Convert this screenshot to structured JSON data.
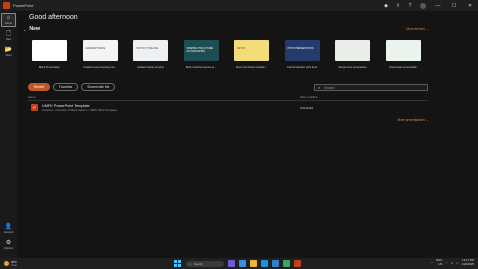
{
  "window": {
    "title": "PowerPoint",
    "controls": {
      "minimize": "—",
      "maximize": "☐",
      "close": "✕"
    },
    "top_icons": [
      "diamond-icon",
      "share-icon",
      "help-icon"
    ]
  },
  "rail": {
    "items": [
      {
        "label": "Home",
        "icon": "⌂",
        "name": "home"
      },
      {
        "label": "New",
        "icon": "🗋",
        "name": "new"
      },
      {
        "label": "Open",
        "icon": "📂",
        "name": "open"
      },
      {
        "label": "Account",
        "icon": "👤",
        "name": "account"
      },
      {
        "label": "Options",
        "icon": "⚙",
        "name": "options"
      }
    ]
  },
  "greeting": "Good afternoon",
  "new_section": {
    "title": "New",
    "more_link": "More themes →",
    "templates": [
      {
        "caption": "Blank Presentation",
        "thumb_text": "",
        "bg": "#ffffff",
        "fg": "#333333"
      },
      {
        "caption": "Gradient wave keynote pres...",
        "thumb_text": "GRADIENT WAVE",
        "bg": "#f4f4f4",
        "fg": "#444444"
      },
      {
        "caption": "Gradient history timeline",
        "thumb_text": "HISTORY TIMELINE",
        "bg": "#eef1f4",
        "fg": "#555555"
      },
      {
        "caption": "Bold underline keynote pr...",
        "thumb_text": "SHAPING THE FUTURE OF INNOVATION",
        "bg": "#1d4f52",
        "fg": "#ffffff"
      },
      {
        "caption": "Retro funk fusion marketin...",
        "thumb_text": "RETRO",
        "bg": "#f2dd7a",
        "fg": "#a33b2e"
      },
      {
        "caption": "Colorful abstract pitch deck",
        "thumb_text": "PITCH PRESENTATION",
        "bg": "#243b6b",
        "fg": "#ffffff"
      },
      {
        "caption": "Simple dune presentation",
        "thumb_text": "",
        "bg": "#e9efe8",
        "fg": "#333333"
      },
      {
        "caption": "Greenscape presentation",
        "thumb_text": "",
        "bg": "#eaf3ec",
        "fg": "#2f6b3c"
      }
    ]
  },
  "tabs": [
    "Recent",
    "Favorites",
    "Shared with Me"
  ],
  "search": {
    "placeholder": "Search"
  },
  "columns": {
    "name": "Name",
    "date": "Date modified"
  },
  "files": [
    {
      "name": "UMFK PowerPoint Template",
      "path": "OneDrive - University of Maine System » UMFK Office Templates",
      "date": "4/11/2018"
    }
  ],
  "more_presentations": "More presentations →",
  "taskbar": {
    "weather_temp": "38°F",
    "weather_cond": "Clear",
    "search_placeholder": "Search",
    "tray_lang": "ENG",
    "tray_region": "US",
    "time": "12:47 PM",
    "date": "1/23/2025"
  }
}
